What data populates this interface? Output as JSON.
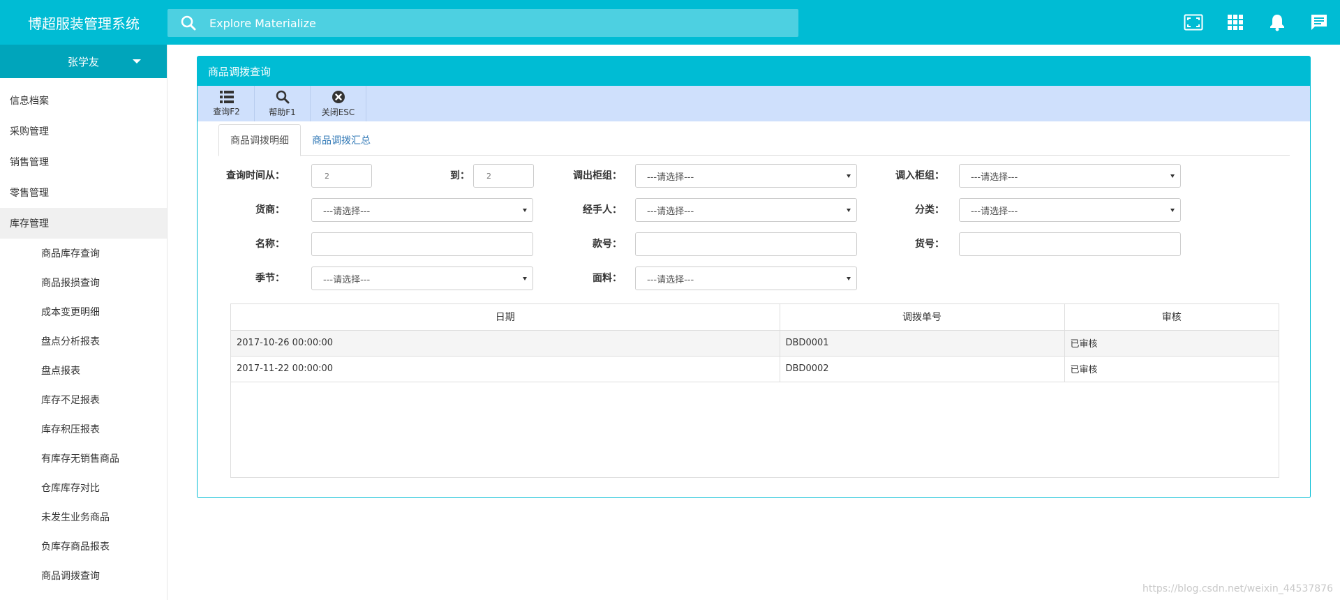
{
  "app": {
    "title": "博超服装管理系统"
  },
  "search": {
    "placeholder": "Explore Materialize"
  },
  "top_icons": [
    "fullscreen-icon",
    "apps-grid-icon",
    "notifications-bell-icon",
    "chat-message-icon"
  ],
  "colors": {
    "primary": "#00bcd4",
    "toolbar": "#cfe0fc",
    "link": "#337ab7"
  },
  "sidebar": {
    "user": "张学友",
    "menu": [
      {
        "label": "信息档案"
      },
      {
        "label": "采购管理"
      },
      {
        "label": "销售管理"
      },
      {
        "label": "零售管理"
      },
      {
        "label": "库存管理",
        "active": true
      }
    ],
    "submenu": [
      {
        "label": "商品库存查询"
      },
      {
        "label": "商品报损查询"
      },
      {
        "label": "成本变更明细"
      },
      {
        "label": "盘点分析报表"
      },
      {
        "label": "盘点报表"
      },
      {
        "label": "库存不足报表"
      },
      {
        "label": "库存积压报表"
      },
      {
        "label": "有库存无销售商品"
      },
      {
        "label": "仓库库存对比"
      },
      {
        "label": "未发生业务商品"
      },
      {
        "label": "负库存商品报表"
      },
      {
        "label": "商品调拨查询"
      }
    ]
  },
  "panel": {
    "title": "商品调拨查询",
    "toolbar": {
      "query": "查询F2",
      "help": "帮助F1",
      "close": "关闭ESC"
    },
    "tabs": {
      "detail": "商品调拨明细",
      "summary": "商品调拨汇总"
    }
  },
  "form": {
    "time_from_label": "查询时间从：",
    "time_from_value": "2",
    "time_to_label": "到：",
    "time_to_value": "2",
    "out_group_label": "调出柜组：",
    "in_group_label": "调入柜组：",
    "vendor_label": "货商：",
    "handler_label": "经手人：",
    "category_label": "分类：",
    "name_label": "名称：",
    "style_label": "款号：",
    "item_no_label": "货号：",
    "season_label": "季节：",
    "fabric_label": "面料：",
    "select_placeholder": "---请选择---"
  },
  "table": {
    "headers": [
      "日期",
      "调拨单号",
      "审核"
    ],
    "rows": [
      [
        "2017-10-26 00:00:00",
        "DBD0001",
        "已审核"
      ],
      [
        "2017-11-22 00:00:00",
        "DBD0002",
        "已审核"
      ]
    ]
  },
  "watermark": "https://blog.csdn.net/weixin_44537876"
}
